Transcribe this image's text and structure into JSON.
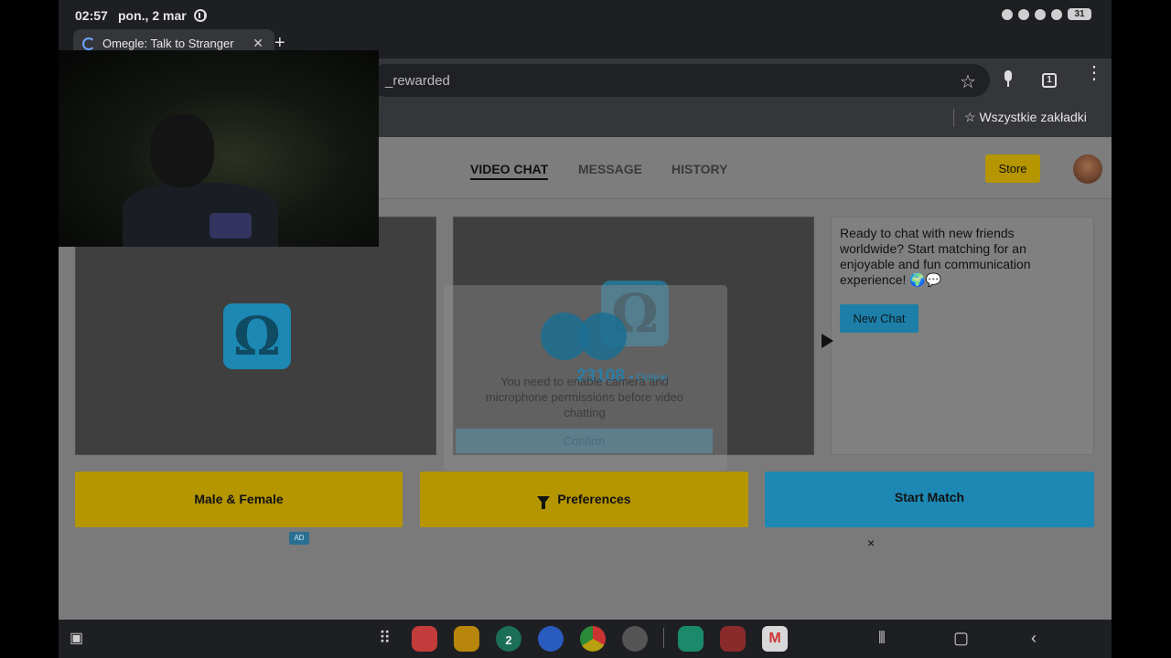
{
  "status_bar": {
    "time": "02:57",
    "date": "pon., 2 mar",
    "battery": "31"
  },
  "browser": {
    "tab_title": "Omegle: Talk to Stranger",
    "url": "_rewarded",
    "bookmarks_all_label": "Wszystkie zakładki",
    "tab_count": "1"
  },
  "site": {
    "nav": {
      "video_chat": "VIDEO CHAT",
      "message": "MESSAGE",
      "history": "HISTORY"
    },
    "store_label": "Store",
    "logo_glyph": "Ω",
    "permission": {
      "online_count": "23108",
      "online_label": "• Online",
      "text": "You need to enable camera and microphone permissions before video chatting",
      "confirm_label": "Confirm"
    },
    "side_text": "Ready to chat with new friends worldwide? Start matching for an enjoyable and fun communication experience! 🌍💬",
    "new_chat_label": "New Chat",
    "gender_label": "Male & Female",
    "preferences_label": "Preferences",
    "start_match_label": "Start Match",
    "ad_label": "AD",
    "ad_close": "×",
    "colors": {
      "accent_yellow": "#b59500",
      "accent_blue": "#1d88b3"
    }
  },
  "taskbar": {
    "calendar_day": "2"
  }
}
